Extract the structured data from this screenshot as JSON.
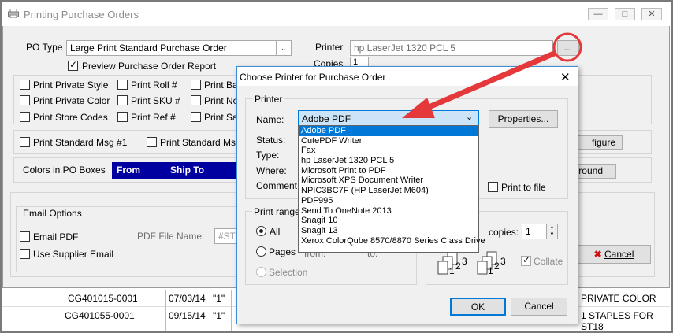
{
  "window": {
    "title": "Printing Purchase Orders"
  },
  "main": {
    "po_type_label": "PO Type",
    "po_type_value": "Large Print Standard Purchase Order",
    "preview_label": "Preview Purchase Order Report",
    "printer_label": "Printer",
    "printer_value": "hp LaserJet 1320 PCL 5",
    "browse_label": "...",
    "copies_label": "Copies",
    "copies_value": "1",
    "options": {
      "private_style": "Print Private Style",
      "private_color": "Print Private Color",
      "store_codes": "Print Store Codes",
      "roll": "Print Roll #",
      "sku": "Print SKU #",
      "ref": "Print Ref #",
      "ba": "Print Ba",
      "no": "Print No",
      "sa": "Print Sa"
    },
    "std_msg1": "Print Standard Msg #1",
    "std_msg_partial": "Print Standard Msg",
    "configure_partial": "figure",
    "colors_label": "Colors in PO Boxes",
    "from_label": "From",
    "shipto_label": "Ship To",
    "round_partial": "round",
    "email_options": "Email Options",
    "email_pdf": "Email PDF",
    "pdf_file_name_label": "PDF File Name:",
    "pdf_file_name_value": "#ST0",
    "use_supplier_email": "Use Supplier Email",
    "cancel_label": "Cancel"
  },
  "grid": {
    "rows": [
      {
        "po": "CG401015-0001",
        "date": "07/03/14",
        "q": "\"1\"",
        "desc": "PRIVATE COLOR"
      },
      {
        "po": "CG401055-0001",
        "date": "09/15/14",
        "q": "\"1\"",
        "desc": "1  STAPLES FOR ST18"
      }
    ]
  },
  "dialog": {
    "title": "Choose Printer for Purchase Order",
    "printer_group": "Printer",
    "name_label": "Name:",
    "name_value": "Adobe PDF",
    "properties_label": "Properties...",
    "status_label": "Status:",
    "type_label": "Type:",
    "where_label": "Where:",
    "comment_label": "Comment:",
    "print_to_file": "Print to file",
    "print_range": "Print range",
    "all": "All",
    "pages": "Pages",
    "from": "from:",
    "to": "to:",
    "selection": "Selection",
    "copies_partial": "copies:",
    "copies_value": "1",
    "collate": "Collate",
    "ok": "OK",
    "cancel": "Cancel",
    "printers": [
      "Adobe PDF",
      "CutePDF Writer",
      "Fax",
      "hp LaserJet 1320 PCL 5",
      "Microsoft Print to PDF",
      "Microsoft XPS Document Writer",
      "NPIC3BC7F (HP LaserJet M604)",
      "PDF995",
      "Send To OneNote 2013",
      "Snagit 10",
      "Snagit 13",
      "Xerox ColorQube 8570/8870 Series Class Drive"
    ]
  },
  "colors": {
    "accent_blue": "#0000a0",
    "selection_blue": "#0078d7",
    "annotation_red": "#e5383b"
  }
}
